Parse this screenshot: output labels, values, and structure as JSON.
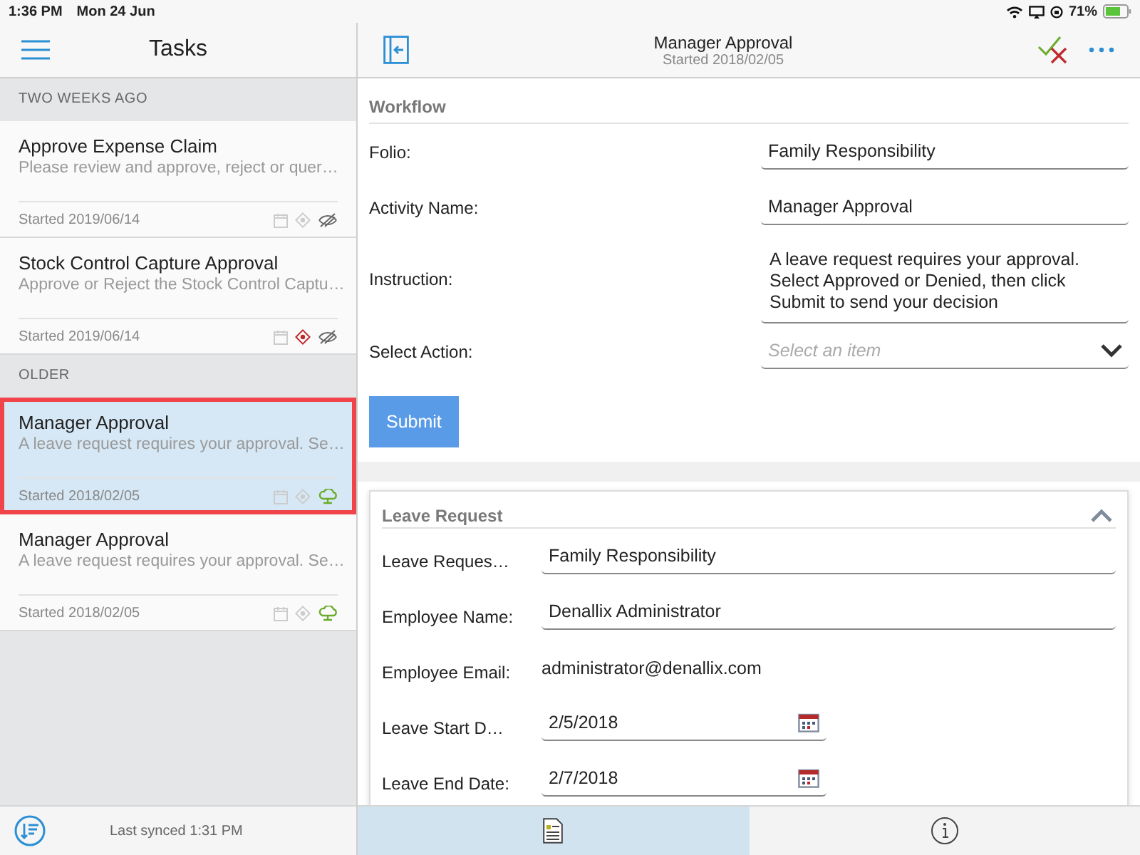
{
  "status_bar": {
    "time": "1:36 PM",
    "date": "Mon 24 Jun",
    "battery": "71%"
  },
  "sidebar": {
    "title": "Tasks",
    "groups": [
      {
        "heading": "TWO WEEKS AGO",
        "tasks": [
          {
            "title": "Approve Expense Claim",
            "description": "Please review and approve, reject or quer…",
            "started": "Started 2019/06/14",
            "high_priority": false,
            "synced": false,
            "selected": false
          },
          {
            "title": "Stock Control Capture Approval",
            "description": "Approve or Reject the Stock Control Captu…",
            "started": "Started 2019/06/14",
            "high_priority": true,
            "synced": false,
            "selected": false
          }
        ]
      },
      {
        "heading": "OLDER",
        "tasks": [
          {
            "title": "Manager Approval",
            "description": "A leave request requires your approval. Se…",
            "started": "Started 2018/02/05",
            "high_priority": false,
            "synced": true,
            "selected": true
          },
          {
            "title": "Manager Approval",
            "description": "A leave request requires your approval. Se…",
            "started": "Started 2018/02/05",
            "high_priority": false,
            "synced": true,
            "selected": false
          }
        ]
      }
    ],
    "footer": "Last synced 1:31 PM"
  },
  "header": {
    "title": "Manager Approval",
    "subtitle": "Started 2018/02/05"
  },
  "workflow": {
    "heading": "Workflow",
    "fields": [
      {
        "kind": "text",
        "label": "Folio:",
        "value": "Family Responsibility"
      },
      {
        "kind": "text",
        "label": "Activity Name:",
        "value": "Manager Approval"
      },
      {
        "kind": "multiline",
        "label": "Instruction:",
        "value": "A leave request requires your approval. Select Approved or Denied, then click Submit to send your decision"
      },
      {
        "kind": "select",
        "label": "Select Action:",
        "placeholder": "Select an item"
      }
    ],
    "button": "Submit"
  },
  "leave_request": {
    "heading": "Leave Request",
    "expanded": true,
    "fields": [
      {
        "kind": "text",
        "label": "Leave Reques…",
        "value": "Family Responsibility"
      },
      {
        "kind": "text",
        "label": "Employee Name:",
        "value": "Denallix Administrator"
      },
      {
        "kind": "plain",
        "label": "Employee Email:",
        "value": "administrator@denallix.com"
      },
      {
        "kind": "date",
        "label": "Leave Start D…",
        "value": "2/5/2018"
      },
      {
        "kind": "date",
        "label": "Leave End Date:",
        "value": "2/7/2018"
      }
    ]
  },
  "bottom_tabs": [
    {
      "kind": "form",
      "selected": true
    },
    {
      "kind": "info",
      "selected": false
    }
  ]
}
